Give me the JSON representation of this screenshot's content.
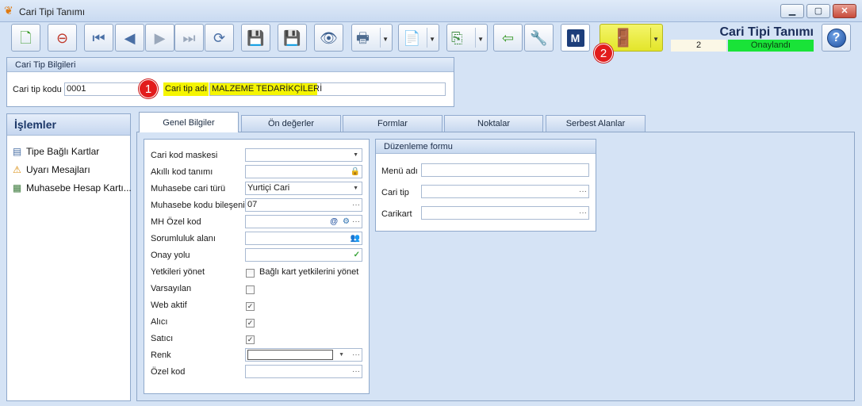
{
  "window": {
    "title": "Cari Tipi Tanımı",
    "minimize": "▁",
    "maximize": "▢",
    "close": "✕"
  },
  "header": {
    "form_title": "Cari Tipi Tanımı",
    "record_number": "2",
    "status": "Onaylandı"
  },
  "badges": {
    "one": "1",
    "two": "2"
  },
  "group_cari_tip": {
    "title": "Cari Tip Bilgileri",
    "code_label": "Cari tip kodu",
    "code_value": "0001",
    "name_label": "Cari tip adı",
    "name_value": "MALZEME TEDARİKÇİLERİ"
  },
  "sidebar": {
    "title": "İşlemler",
    "items": [
      {
        "label": "Tipe Bağlı Kartlar"
      },
      {
        "label": "Uyarı Mesajları"
      },
      {
        "label": "Muhasebe Hesap Kartı..."
      }
    ]
  },
  "tabs": [
    {
      "label": "Genel Bilgiler"
    },
    {
      "label": "Ön değerler"
    },
    {
      "label": "Formlar"
    },
    {
      "label": "Noktalar"
    },
    {
      "label": "Serbest Alanlar"
    }
  ],
  "general": {
    "cari_kod_maskesi": {
      "label": "Cari kod maskesi",
      "value": ""
    },
    "akilli_kod": {
      "label": "Akıllı kod tanımı",
      "value": ""
    },
    "muhasebe_cari_turu": {
      "label": "Muhasebe cari türü",
      "value": "Yurtiçi Cari"
    },
    "muhasebe_kodu_bileseni": {
      "label": "Muhasebe kodu bileşeni",
      "value": "07"
    },
    "mh_ozel_kod": {
      "label": "MH Özel kod",
      "value": ""
    },
    "sorumluluk_alani": {
      "label": "Sorumluluk alanı",
      "value": ""
    },
    "onay_yolu": {
      "label": "Onay yolu",
      "value": ""
    },
    "yetkileri_yonet": {
      "label": "Yetkileri yönet",
      "checkbox_label": "Bağlı kart yetkilerini yönet",
      "checked": false
    },
    "varsayilan": {
      "label": "Varsayılan",
      "checked": false
    },
    "web_aktif": {
      "label": "Web aktif",
      "checked": true
    },
    "alici": {
      "label": "Alıcı",
      "checked": true
    },
    "satici": {
      "label": "Satıcı",
      "checked": true
    },
    "renk": {
      "label": "Renk",
      "value": ""
    },
    "ozel_kod": {
      "label": "Özel kod",
      "value": ""
    },
    "ellipsis": "···",
    "check_mark": "✓"
  },
  "duzenleme": {
    "title": "Düzenleme formu",
    "menu_adi": {
      "label": "Menü adı",
      "value": ""
    },
    "cari_tip": {
      "label": "Cari tip",
      "value": ""
    },
    "carikart": {
      "label": "Carikart",
      "value": ""
    }
  },
  "toolbar_icons": [
    "new-icon",
    "delete-icon",
    "first-record-icon",
    "previous-record-icon",
    "next-record-icon",
    "last-record-icon",
    "refresh-icon",
    "save-icon",
    "save-close-icon",
    "preview-icon",
    "print-icon",
    "pdf-export-icon",
    "copy-icon",
    "import-icon",
    "tools-icon",
    "m-icon",
    "exit-icon",
    "help-icon"
  ],
  "colors": {
    "status_green": "#19e338",
    "exit_yellow": "#e3e52a",
    "highlight_yellow": "#f5f500",
    "badge_red": "#e21c1c"
  }
}
